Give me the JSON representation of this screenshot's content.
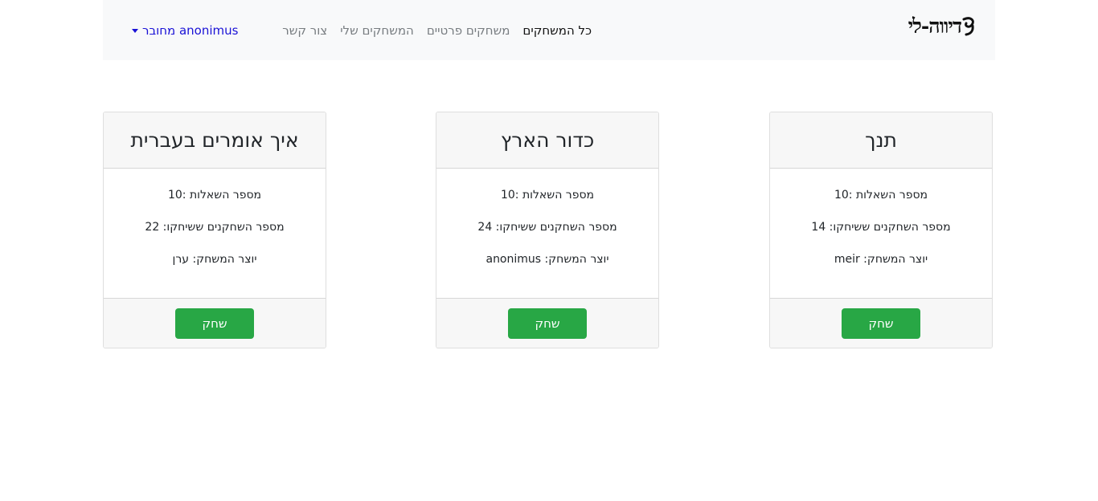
{
  "navbar": {
    "brand": "דיווה-לי",
    "links": [
      {
        "label": "כל המשחקים"
      },
      {
        "label": "משחקים פרטיים"
      },
      {
        "label": "המשחקים שלי"
      },
      {
        "label": "צור קשר"
      }
    ],
    "user": "מחובר anonimus"
  },
  "games": [
    {
      "title": "תנך",
      "questions": "מספר השאלות :10",
      "players": "מספר השחקנים ששיחקו: 14",
      "creator": "יוצר המשחק: meir",
      "play_label": "שחק"
    },
    {
      "title": "כדור הארץ",
      "questions": "מספר השאלות :10",
      "players": "מספר השחקנים ששיחקו: 24",
      "creator": "יוצר המשחק: anonimus",
      "play_label": "שחק"
    },
    {
      "title": "איך אומרים בעברית",
      "questions": "מספר השאלות :10",
      "players": "מספר השחקנים ששיחקו: 22",
      "creator": "יוצר המשחק: ערן",
      "play_label": "שחק"
    }
  ],
  "colors": {
    "primary_button": "#28a745",
    "nav_background": "#f8f9fa",
    "user_link": "#1a12d6"
  }
}
